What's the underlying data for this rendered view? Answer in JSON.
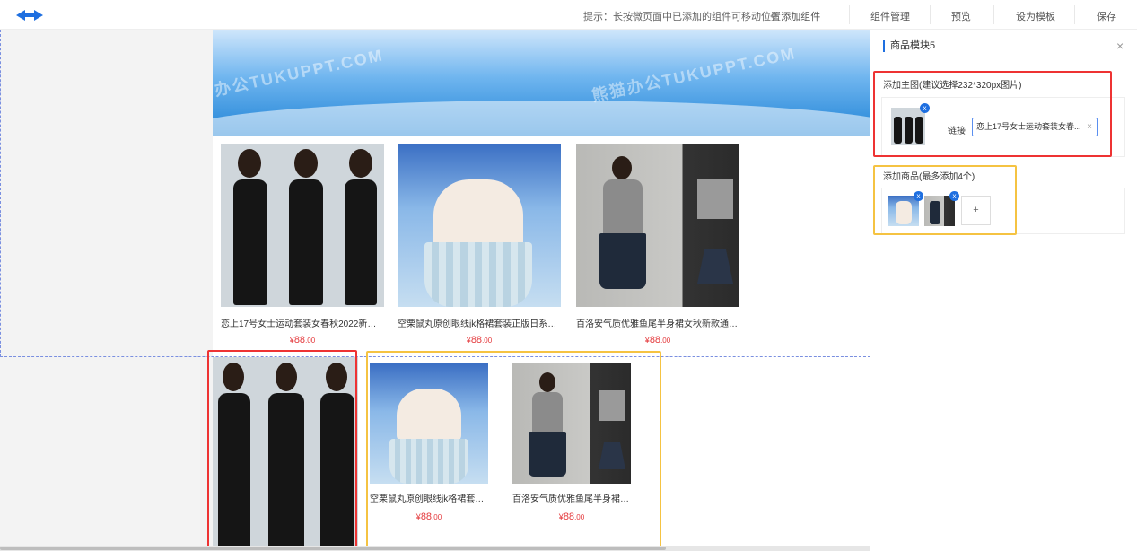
{
  "topbar": {
    "hint": "提示：长按微页面中已添加的组件可移动位置",
    "add_component": "添加组件",
    "component_manage": "组件管理",
    "preview": "预览",
    "set_template": "设为模板",
    "save": "保存"
  },
  "canvas": {
    "banner_watermarks": [
      "办公TUKUPPT.COM",
      "熊猫办公TUKUPPT.COM"
    ],
    "products": [
      {
        "title": "恋上17号女士运动套装女春秋2022新款洋...",
        "price_currency": "¥",
        "price_int": "88",
        "price_dec": ".00"
      },
      {
        "title": "空栗鼠丸原创眼线jk格裙套装正版日系学院...",
        "price_currency": "¥",
        "price_int": "88",
        "price_dec": ".00"
      },
      {
        "title": "百洛安气质优雅鱼尾半身裙女秋新款通勤...",
        "price_currency": "¥",
        "price_int": "88",
        "price_dec": ".00"
      }
    ],
    "module2_products": [
      {
        "title": "空栗鼠丸原创眼线jk格裙套装...",
        "price_currency": "¥",
        "price_int": "88",
        "price_dec": ".00"
      },
      {
        "title": "百洛安气质优雅鱼尾半身裙女...",
        "price_currency": "¥",
        "price_int": "88",
        "price_dec": ".00"
      }
    ]
  },
  "panel": {
    "title": "商品模块5",
    "main_image_label": "添加主图(建议选择232*320px图片)",
    "link_label": "链接",
    "link_value": "恋上17号女士运动套装女春...",
    "add_products_label": "添加商品(最多添加4个)",
    "add_button": "+",
    "remove_badge": "x",
    "close": "×",
    "clear": "×"
  },
  "colors": {
    "accent": "#1e6fe0",
    "price": "#e4393c",
    "highlight_red": "#ee3333",
    "highlight_yellow": "#f5c342"
  }
}
